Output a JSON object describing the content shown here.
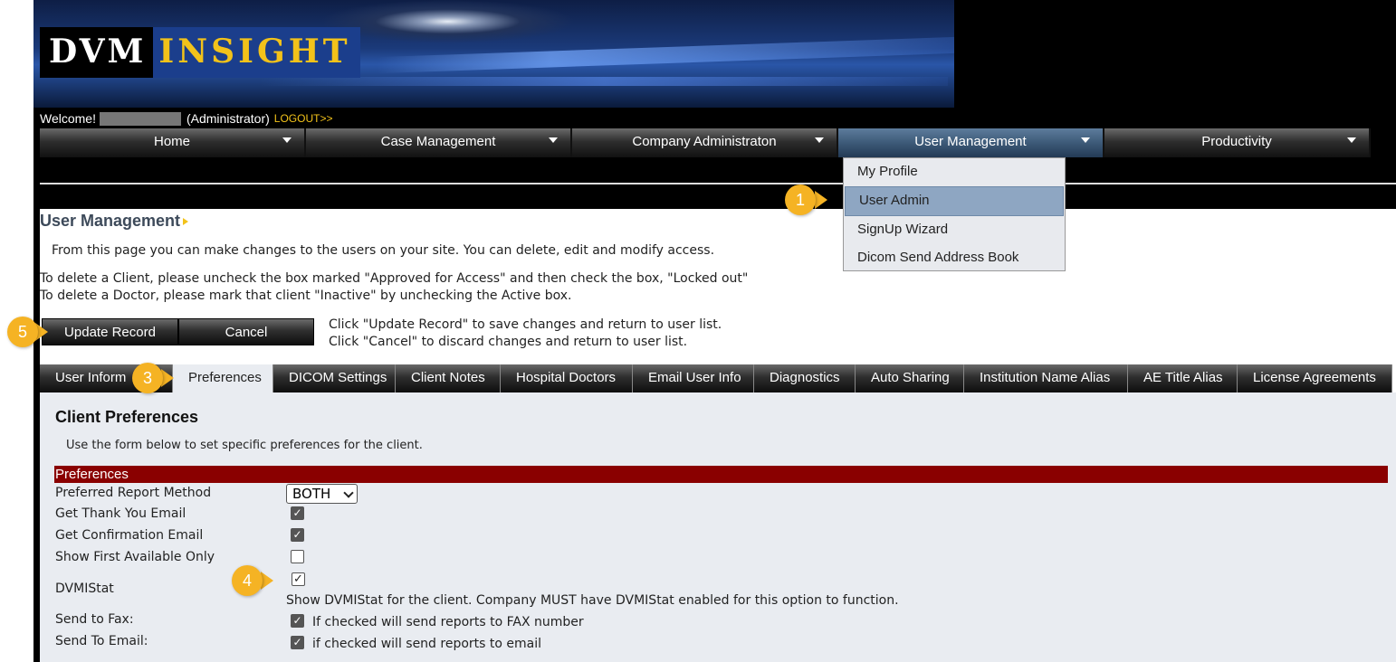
{
  "header": {
    "logo_dvm": "DVM",
    "logo_insight": "INSIGHT",
    "welcome": "Welcome!",
    "role": "(Administrator)",
    "logout": "LOGOUT>>"
  },
  "nav": {
    "items": [
      {
        "label": "Home"
      },
      {
        "label": "Case Management"
      },
      {
        "label": "Company Administraton"
      },
      {
        "label": "User Management"
      },
      {
        "label": "Productivity"
      }
    ]
  },
  "dropdown": {
    "items": [
      {
        "label": "My Profile"
      },
      {
        "label": "User Admin"
      },
      {
        "label": "SignUp Wizard"
      },
      {
        "label": "Dicom Send Address Book"
      }
    ]
  },
  "page": {
    "title": "User Management",
    "intro": "From this page you can make changes to the users on your site. You can delete, edit and modify access.",
    "delete_client": "To delete a Client, please uncheck the box marked \"Approved for Access\" and then check the box, \"Locked out\"",
    "delete_doctor": "To delete a Doctor, please mark that client \"Inactive\" by unchecking the Active box.",
    "update_label": "Update Record",
    "cancel_label": "Cancel",
    "update_hint": "Click \"Update Record\" to save changes and return to user list.",
    "cancel_hint": "Click \"Cancel\" to discard changes and return to user list."
  },
  "tabs": [
    {
      "label": "User Inform"
    },
    {
      "label": "Preferences"
    },
    {
      "label": "DICOM Settings"
    },
    {
      "label": "Client Notes"
    },
    {
      "label": "Hospital Doctors"
    },
    {
      "label": "Email User Info"
    },
    {
      "label": "Diagnostics"
    },
    {
      "label": "Auto Sharing"
    },
    {
      "label": "Institution Name Alias"
    },
    {
      "label": "AE Title Alias"
    },
    {
      "label": "License Agreements"
    }
  ],
  "prefs": {
    "heading": "Client Preferences",
    "subtitle": "Use the form below to set specific preferences for the client.",
    "section": "Preferences",
    "report_method_label": "Preferred Report Method",
    "report_method_value": "BOTH",
    "thank_you_label": "Get Thank You Email",
    "confirmation_label": "Get Confirmation Email",
    "first_available_label": "Show First Available Only",
    "dvmistat_label": "DVMIStat",
    "dvmistat_desc": "Show DVMIStat for the client. Company MUST have DVMIStat enabled for this option to function.",
    "fax_label": "Send to Fax:",
    "fax_desc": "If checked will send reports to FAX number",
    "email_label": "Send To Email:",
    "email_desc": "if checked will send reports to email"
  },
  "callouts": [
    "1",
    "3",
    "4",
    "5"
  ],
  "colors": {
    "accent": "#f5b324",
    "section_bar": "#8a0000",
    "logo_gold": "#f2c21a"
  }
}
